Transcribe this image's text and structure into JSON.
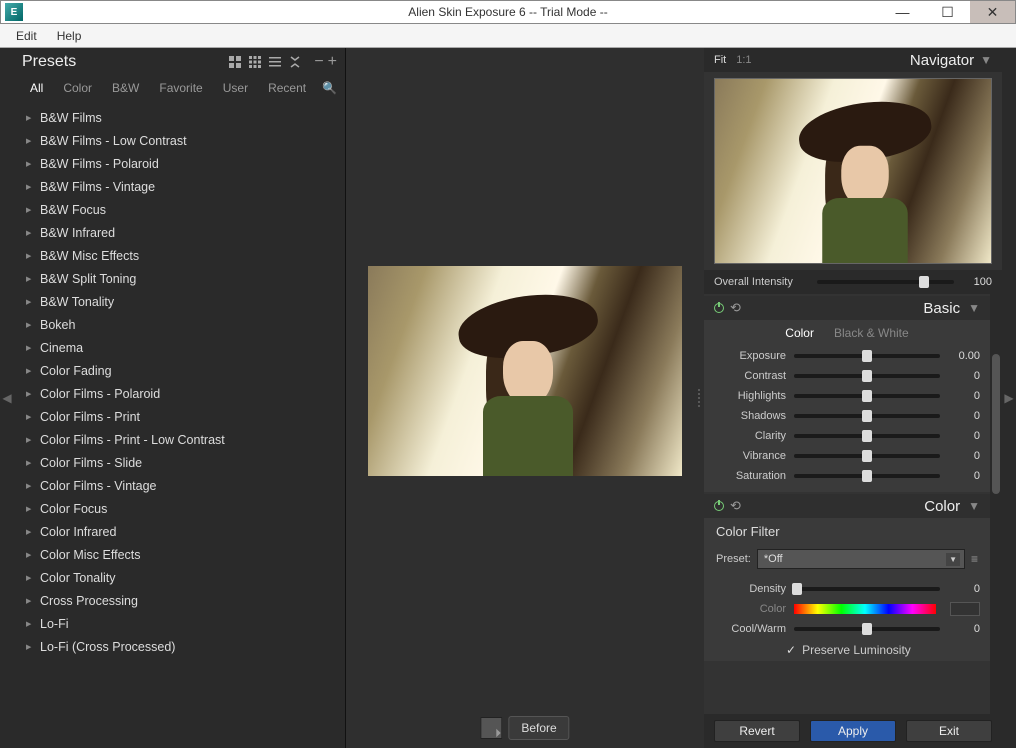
{
  "window": {
    "title": "Alien Skin Exposure 6 -- Trial Mode --"
  },
  "menu": {
    "edit": "Edit",
    "help": "Help"
  },
  "presets": {
    "title": "Presets",
    "tabs": {
      "all": "All",
      "color": "Color",
      "bw": "B&W",
      "favorite": "Favorite",
      "user": "User",
      "recent": "Recent"
    },
    "items": [
      "B&W Films",
      "B&W Films - Low Contrast",
      "B&W Films - Polaroid",
      "B&W Films - Vintage",
      "B&W Focus",
      "B&W Infrared",
      "B&W Misc Effects",
      "B&W Split Toning",
      "B&W Tonality",
      "Bokeh",
      "Cinema",
      "Color Fading",
      "Color Films - Polaroid",
      "Color Films - Print",
      "Color Films - Print - Low Contrast",
      "Color Films - Slide",
      "Color Films - Vintage",
      "Color Focus",
      "Color Infrared",
      "Color Misc Effects",
      "Color Tonality",
      "Cross Processing",
      "Lo-Fi",
      "Lo-Fi (Cross Processed)"
    ]
  },
  "center": {
    "before": "Before"
  },
  "navigator": {
    "fit": "Fit",
    "oneone": "1:1",
    "title": "Navigator"
  },
  "intensity": {
    "label": "Overall Intensity",
    "value": "100"
  },
  "basic": {
    "title": "Basic",
    "color_tab": "Color",
    "bw_tab": "Black & White",
    "sliders": [
      {
        "label": "Exposure",
        "value": "0.00"
      },
      {
        "label": "Contrast",
        "value": "0"
      },
      {
        "label": "Highlights",
        "value": "0"
      },
      {
        "label": "Shadows",
        "value": "0"
      },
      {
        "label": "Clarity",
        "value": "0"
      },
      {
        "label": "Vibrance",
        "value": "0"
      },
      {
        "label": "Saturation",
        "value": "0"
      }
    ]
  },
  "color": {
    "title": "Color",
    "filter_label": "Color Filter",
    "preset_label": "Preset:",
    "preset_value": "*Off",
    "density_label": "Density",
    "density_value": "0",
    "color_label": "Color",
    "coolwarm_label": "Cool/Warm",
    "coolwarm_value": "0",
    "preserve": "Preserve Luminosity"
  },
  "actions": {
    "revert": "Revert",
    "apply": "Apply",
    "exit": "Exit"
  }
}
